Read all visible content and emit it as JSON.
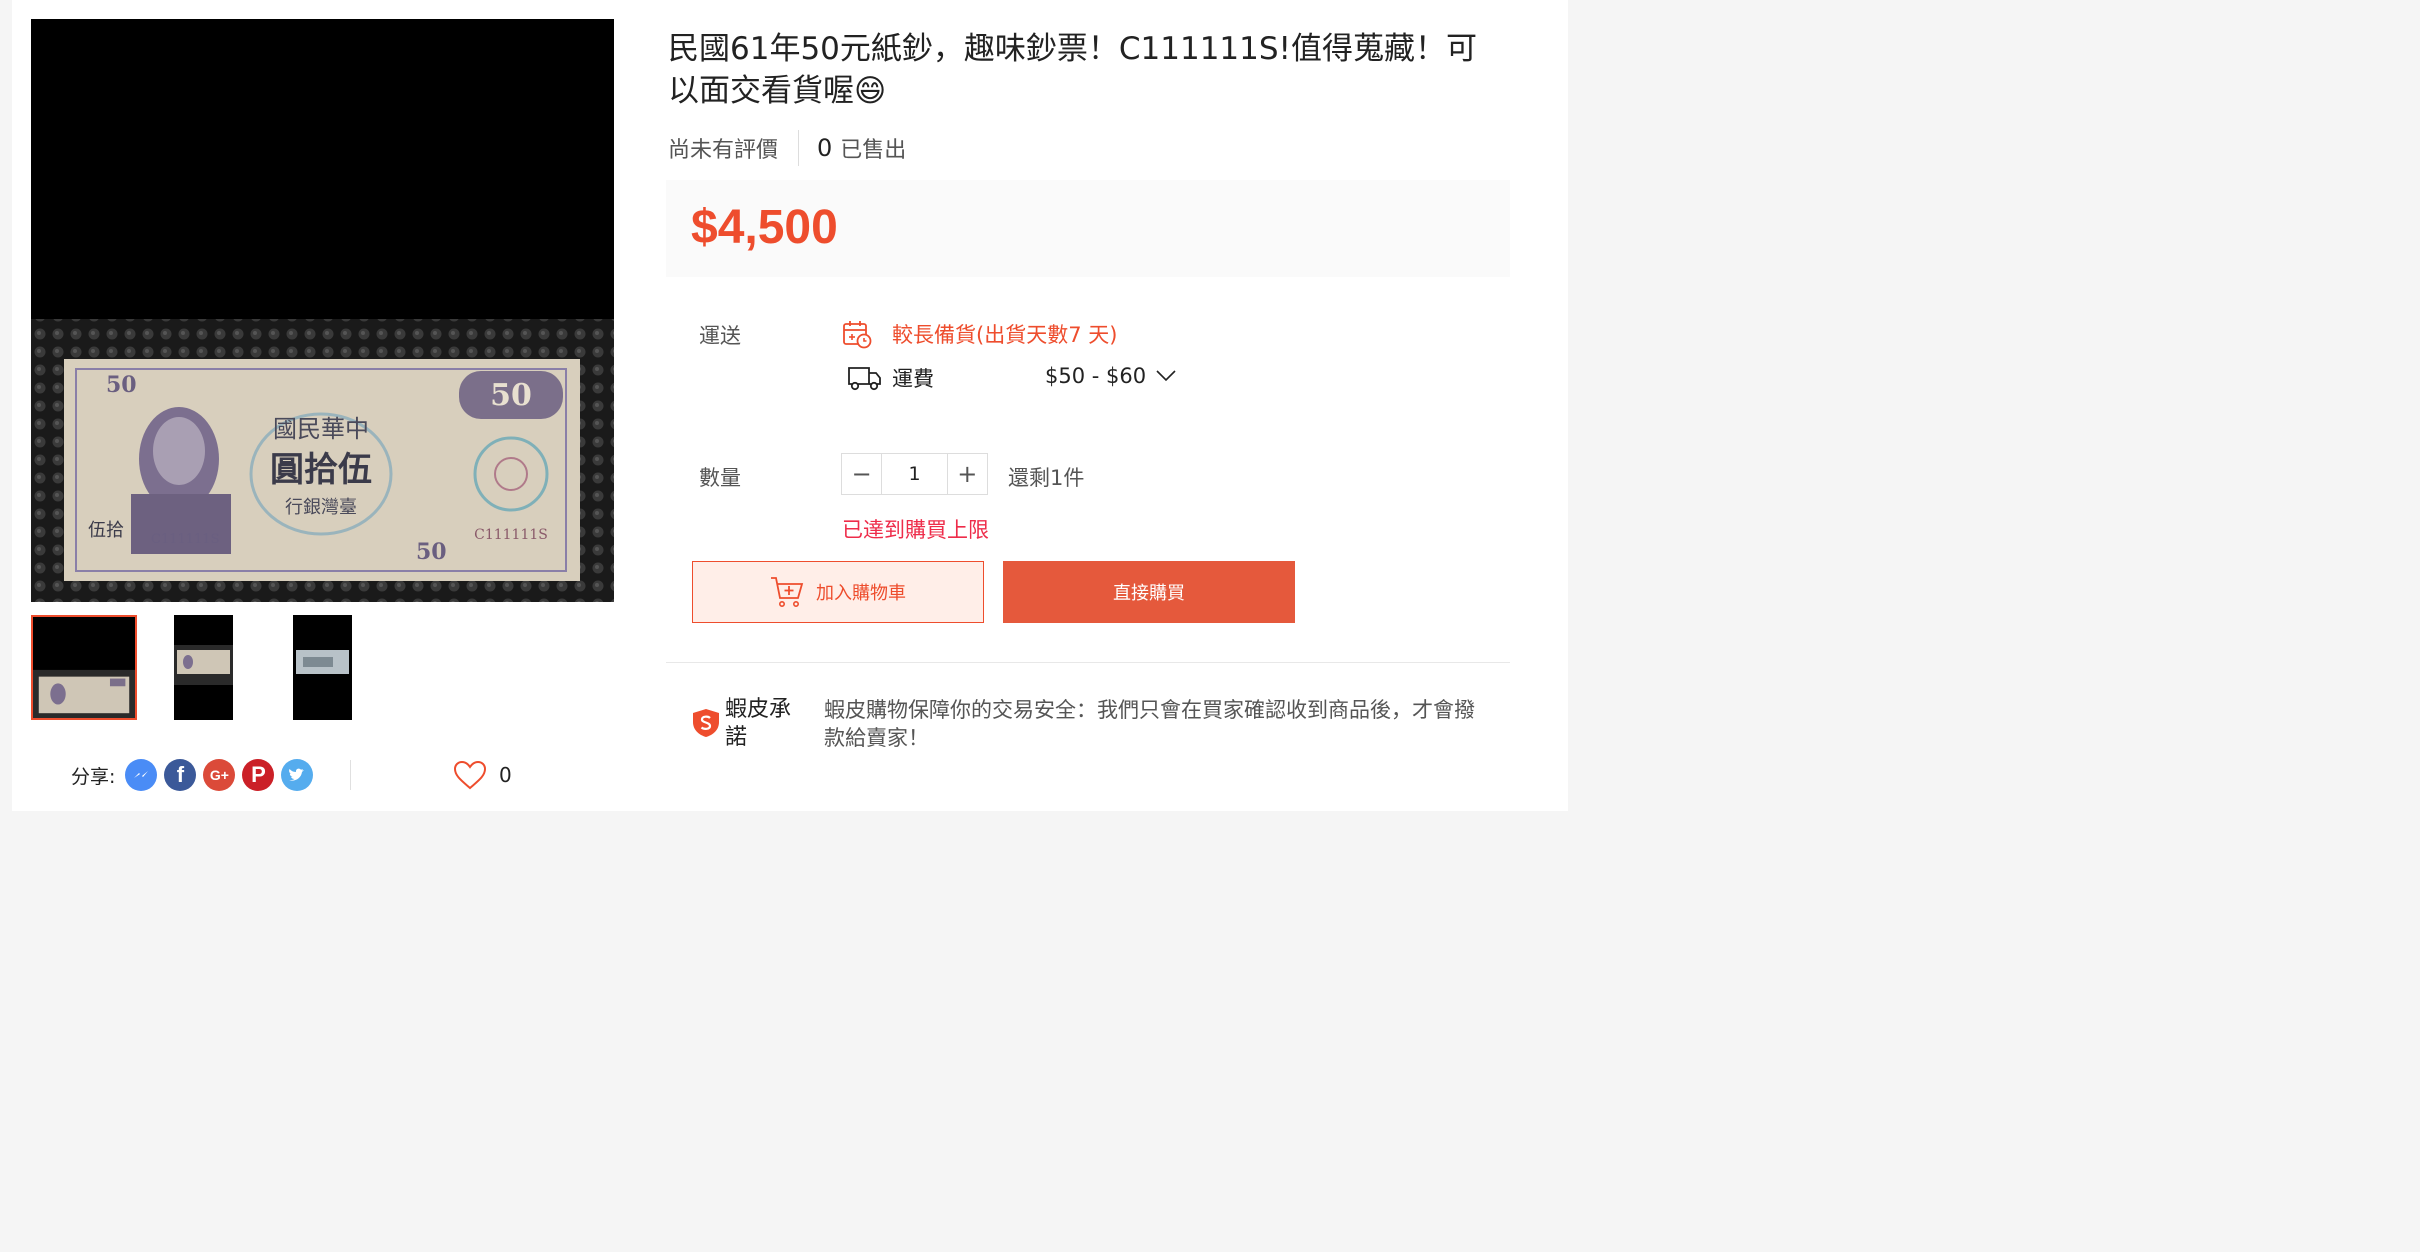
{
  "product": {
    "title": "民國61年50元紙鈔，趣味鈔票！C111111S!值得蒐藏！可以面交看貨喔😄",
    "rating_text": "尚未有評價",
    "sold_count": "0",
    "sold_label": "已售出",
    "price": "$4,500"
  },
  "banknote": {
    "denomination": "50",
    "serial": "C111111S",
    "text_top": "國民華中",
    "text_mid": "圓拾伍",
    "text_bottom": "行銀灣臺",
    "corner_chinese": "伍拾"
  },
  "shipping": {
    "label": "運送",
    "highlight": "較長備貨(出貨天數7 天)",
    "fee_label": "運費",
    "fee_value": "$50 - $60"
  },
  "quantity": {
    "label": "數量",
    "value": "1",
    "minus": "−",
    "plus": "+",
    "stock_text": "還剩1件",
    "limit_message": "已達到購買上限"
  },
  "actions": {
    "add_to_cart": "加入購物車",
    "buy_now": "直接購買"
  },
  "guarantee": {
    "title": "蝦皮承諾",
    "text": "蝦皮購物保障你的交易安全：我們只會在買家確認收到商品後，才會撥款給賣家！"
  },
  "social": {
    "share_label": "分享:",
    "like_count": "0",
    "icons": [
      "messenger-icon",
      "facebook-icon",
      "google-plus-icon",
      "pinterest-icon",
      "twitter-icon"
    ]
  },
  "colors": {
    "accent": "#ee4d2d",
    "limit_text": "#ee2c4a",
    "buy_button": "#e5593c",
    "price_box": "#fafafa"
  }
}
